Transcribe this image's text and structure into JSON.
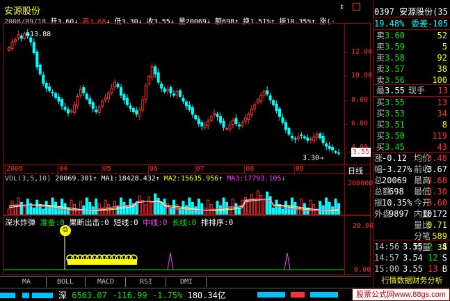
{
  "header": {
    "stock_name": "安源股份",
    "date": "2008/09/18",
    "open_label": "开",
    "open": "3.60",
    "high_label": "高",
    "high": "3.68",
    "low_label": "低",
    "low": "3.30",
    "close_label": "收",
    "close": "3.55",
    "volume_label": "量",
    "volume": "20069",
    "amount_label": "额",
    "amount": "698",
    "turnover_label": "换",
    "turnover": "1.51%",
    "amplitude_label": "振",
    "amplitude": "10.35%",
    "change_label": "涨(-",
    "top_icon": "↕"
  },
  "price_chart": {
    "y_ticks": [
      "12.00",
      "10.00",
      "8.00",
      "6.00",
      "4.00"
    ],
    "max_label": "13.88",
    "min_label": "3.30",
    "current_price_tag": "3.55",
    "x_ticks": [
      "2008",
      "04",
      "05",
      "06",
      "07",
      "08",
      "09"
    ],
    "period_label": "日线"
  },
  "volume_chart": {
    "title": "VOL(3,5,10)",
    "vol": "20069.301",
    "ma1": "MA1:18428.432",
    "ma2": "MA2:15635.956",
    "ma3": "MA3:17793.105",
    "y_tick": "200000",
    "y_unit": "×1"
  },
  "indicator": {
    "title": "深水炸弹",
    "zhunbei": "准备:0",
    "guoduan": "果断出击:0",
    "duanxian": "短线:0",
    "zhongxian": "中线:0",
    "changxian": "长线:0",
    "paipaixu": "排排序:0",
    "y_top": "20.00",
    "y_bottom": "0.00",
    "smiley": "☺"
  },
  "bottom_tabs": [
    "MA",
    "BOLL",
    "MACD",
    "RSI",
    "DMI"
  ],
  "status_bar": {
    "index_name": "深",
    "index_value": "6563.07",
    "index_change": "-116.99",
    "index_pct": "-1.75%",
    "turnover": "180.34亿"
  },
  "side_panel": {
    "code": "0397",
    "name": "安源股份",
    "code_suffix": "(35",
    "weibi": "19.48%",
    "weicha": "委差-105",
    "sells": [
      {
        "label": "卖",
        "price": "3.60",
        "vol": "52"
      },
      {
        "label": "卖",
        "price": "3.59",
        "vol": "5"
      },
      {
        "label": "卖",
        "price": "3.58",
        "vol": "92"
      },
      {
        "label": "卖",
        "price": "3.57",
        "vol": "38"
      },
      {
        "label": "卖",
        "price": "3.56",
        "vol": "100"
      }
    ],
    "last": {
      "label": "最",
      "price": "3.55",
      "text": "现手",
      "vol": "13"
    },
    "buys": [
      {
        "label": "买",
        "price": "3.55",
        "vol": "13"
      },
      {
        "label": "买",
        "price": "3.53",
        "vol": "34"
      },
      {
        "label": "买",
        "price": "3.51",
        "vol": "8"
      },
      {
        "label": "买",
        "price": "3.50",
        "vol": "119"
      },
      {
        "label": "买",
        "price": "3.45",
        "vol": "43"
      }
    ],
    "stats": [
      {
        "l": "涨",
        "lv": "-0.12",
        "m": "均价",
        "mv": "3.48"
      },
      {
        "l": "幅",
        "lv": "-3.27%",
        "m": "前收",
        "mv": "3.67"
      },
      {
        "l": "总",
        "lv": "20069",
        "m": "最高",
        "mv": "3.68"
      },
      {
        "l": "总额",
        "lv": "698",
        "m": "最低",
        "mv": "3.30"
      },
      {
        "l": "振",
        "lv": "10.35%",
        "m": "今开",
        "mv": "3.60"
      },
      {
        "l": "外盘",
        "lv": "9897",
        "m": "内盘",
        "mv": "10172"
      }
    ],
    "ticks": [
      {
        "t": "14:56",
        "p": "3.55",
        "v": "2",
        "s": "S"
      },
      {
        "t": "14:57",
        "p": "3.54",
        "v": "12",
        "s": "S"
      },
      {
        "t": "15:00",
        "p": "3.55",
        "v": "13",
        "s": "B"
      }
    ],
    "stats2": [
      {
        "l": "量比",
        "v": "0.71"
      },
      {
        "l": "分笔",
        "v": "589"
      },
      {
        "l": "均量",
        "v": "34"
      }
    ],
    "footer_text": "行情数据财务分析",
    "brand": "股票公式网www.88gs.com"
  },
  "colors": {
    "up": "#ff3232",
    "down": "#00ffff",
    "frame": "#a00000",
    "ma1": "#ffffff",
    "ma2": "#ffff00",
    "ma3": "#ff40ff"
  },
  "chart_data": {
    "type": "line",
    "title": "",
    "xlabel": "",
    "ylabel": "",
    "ylim": [
      2.8,
      14.2
    ],
    "x_month_labels": [
      "2008",
      "04",
      "05",
      "06",
      "07",
      "08",
      "09"
    ],
    "close": [
      12.4,
      12.9,
      13.1,
      13.5,
      13.2,
      13.6,
      13.4,
      12.9,
      12.0,
      10.8,
      10.2,
      9.4,
      9.0,
      8.8,
      8.6,
      8.2,
      7.9,
      7.5,
      7.2,
      6.9,
      7.1,
      7.6,
      8.3,
      8.9,
      8.6,
      8.1,
      7.7,
      7.3,
      7.0,
      7.4,
      7.9,
      8.2,
      8.6,
      9.0,
      9.5,
      9.1,
      8.4,
      8.0,
      7.6,
      7.3,
      7.0,
      6.8,
      7.2,
      8.0,
      9.2,
      10.0,
      10.8,
      10.2,
      9.5,
      9.0,
      8.7,
      8.9,
      8.6,
      8.4,
      8.7,
      8.3,
      7.9,
      7.5,
      7.2,
      6.8,
      6.4,
      6.0,
      5.8,
      5.9,
      6.2,
      6.6,
      6.9,
      6.6,
      6.1,
      5.7,
      5.6,
      5.9,
      6.3,
      6.0,
      5.8,
      6.1,
      6.5,
      6.8,
      7.2,
      7.6,
      8.0,
      8.4,
      8.7,
      8.5,
      8.0,
      7.6,
      7.1,
      6.6,
      6.1,
      5.5,
      5.1,
      4.8,
      4.7,
      4.9,
      5.0,
      4.8,
      4.6,
      4.7,
      4.9,
      5.1,
      4.8,
      4.4,
      4.1,
      3.9,
      3.8,
      3.6,
      3.55
    ]
  }
}
